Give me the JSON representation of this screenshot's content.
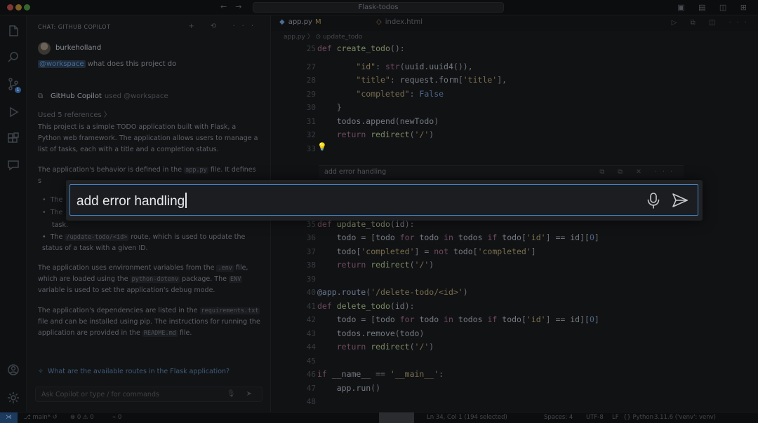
{
  "titlebar": {
    "search_text": "Flask-todos"
  },
  "activity": {
    "scm_badge": "1",
    "accounts_badge": ""
  },
  "chat": {
    "header": "CHAT: GITHUB COPILOT",
    "user": {
      "name": "burkeholland",
      "mention": "@workspace",
      "message": " what does this project do"
    },
    "copilot": {
      "name": "GitHub Copilot",
      "used": "used @workspace"
    },
    "used_refs": "Used 5 references",
    "para1": "This project is a simple TODO application built with Flask, a Python web framework. The application allows users to manage a list of tasks, each with a title and a completion status.",
    "para2_pre": "The application's behavior is defined in the ",
    "para2_code": "app.py",
    "para2_post": " file. It defines s",
    "bullet3_pre": "The ",
    "bullet3_code": "/update-todo/<id>",
    "bullet3_post": " route, which is used to update the status of a task with a given ID.",
    "bullet2_tail": "task.",
    "para3_a": "The application uses environment variables from the ",
    "para3_code1": ".env",
    "para3_b": " file, which are loaded using the ",
    "para3_code2": "python-dotenv",
    "para3_c": " package. The ",
    "para3_code3": "ENV",
    "para3_d": " variable is used to set the application's debug mode.",
    "para4_a": "The application's dependencies are listed in the ",
    "para4_code1": "requirements.txt",
    "para4_b": " file and can be installed using pip. The instructions for running the application are provided in the ",
    "para4_code2": "README.md",
    "para4_c": " file.",
    "suggestion": "What are the available routes in the Flask application?",
    "input_placeholder": "Ask Copilot or type / for commands"
  },
  "editor": {
    "tabs": [
      {
        "label": "app.py",
        "modified": "M"
      },
      {
        "label": "index.html",
        "modified": ""
      }
    ],
    "breadcrumb": "app.py  〉 ⊙ update_todo",
    "inline_chat_label": "add error handling",
    "lines_top": [
      {
        "n": "25"
      },
      {
        "n": "27"
      },
      {
        "n": "28"
      },
      {
        "n": "29"
      },
      {
        "n": "30"
      },
      {
        "n": "31"
      },
      {
        "n": "32"
      },
      {
        "n": "33"
      }
    ],
    "lines_bottom": [
      {
        "n": "35"
      },
      {
        "n": "36"
      },
      {
        "n": "37"
      },
      {
        "n": "38"
      },
      {
        "n": "39"
      },
      {
        "n": "40"
      },
      {
        "n": "41"
      },
      {
        "n": "42"
      },
      {
        "n": "43"
      },
      {
        "n": "44"
      },
      {
        "n": "45"
      },
      {
        "n": "46"
      },
      {
        "n": "47"
      },
      {
        "n": "48"
      }
    ]
  },
  "inline_chat": {
    "value": "add error handling",
    "mic_icon": "microphone-icon",
    "send_icon": "send-icon"
  },
  "status": {
    "branch": "⎇ main* ↺",
    "problems": "⊗ 0 ⚠ 0",
    "ports": "⌁ 0",
    "position": "Ln 34, Col 1 (194 selected)",
    "spaces": "Spaces: 4",
    "encoding": "UTF-8",
    "eol": "LF",
    "language": "{} Python",
    "interpreter": "3.11.6 ('venv': venv)"
  }
}
